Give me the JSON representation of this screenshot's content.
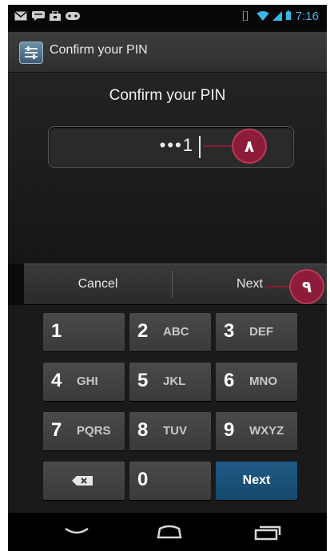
{
  "status_bar": {
    "time": "7:16",
    "left_icons": [
      "mail-icon",
      "chat-icon",
      "bag-icon",
      "controller-icon"
    ],
    "right_icons": [
      "vibrate-icon",
      "wifi-icon",
      "signal-icon",
      "battery-icon"
    ],
    "accent": "#3ab5e6"
  },
  "action_bar": {
    "title": "Confirm your PIN",
    "icon": "settings-app-icon"
  },
  "prompt": "Confirm your PIN",
  "pin_field": {
    "value": "•••1"
  },
  "callouts": [
    "٨",
    "٩"
  ],
  "action_row": {
    "cancel_label": "Cancel",
    "next_label": "Next"
  },
  "keypad": {
    "keys": [
      {
        "number": "1",
        "letters": ""
      },
      {
        "number": "2",
        "letters": "ABC"
      },
      {
        "number": "3",
        "letters": "DEF"
      },
      {
        "number": "4",
        "letters": "GHI"
      },
      {
        "number": "5",
        "letters": "JKL"
      },
      {
        "number": "6",
        "letters": "MNO"
      },
      {
        "number": "7",
        "letters": "PQRS"
      },
      {
        "number": "8",
        "letters": "TUV"
      },
      {
        "number": "9",
        "letters": "WXYZ"
      }
    ],
    "zero": "0",
    "next_label": "Next",
    "backspace_icon": "backspace-icon",
    "next_color": "#1e5a84"
  },
  "nav_bar": {
    "icons": [
      "back-icon",
      "home-icon",
      "recent-apps-icon"
    ]
  }
}
